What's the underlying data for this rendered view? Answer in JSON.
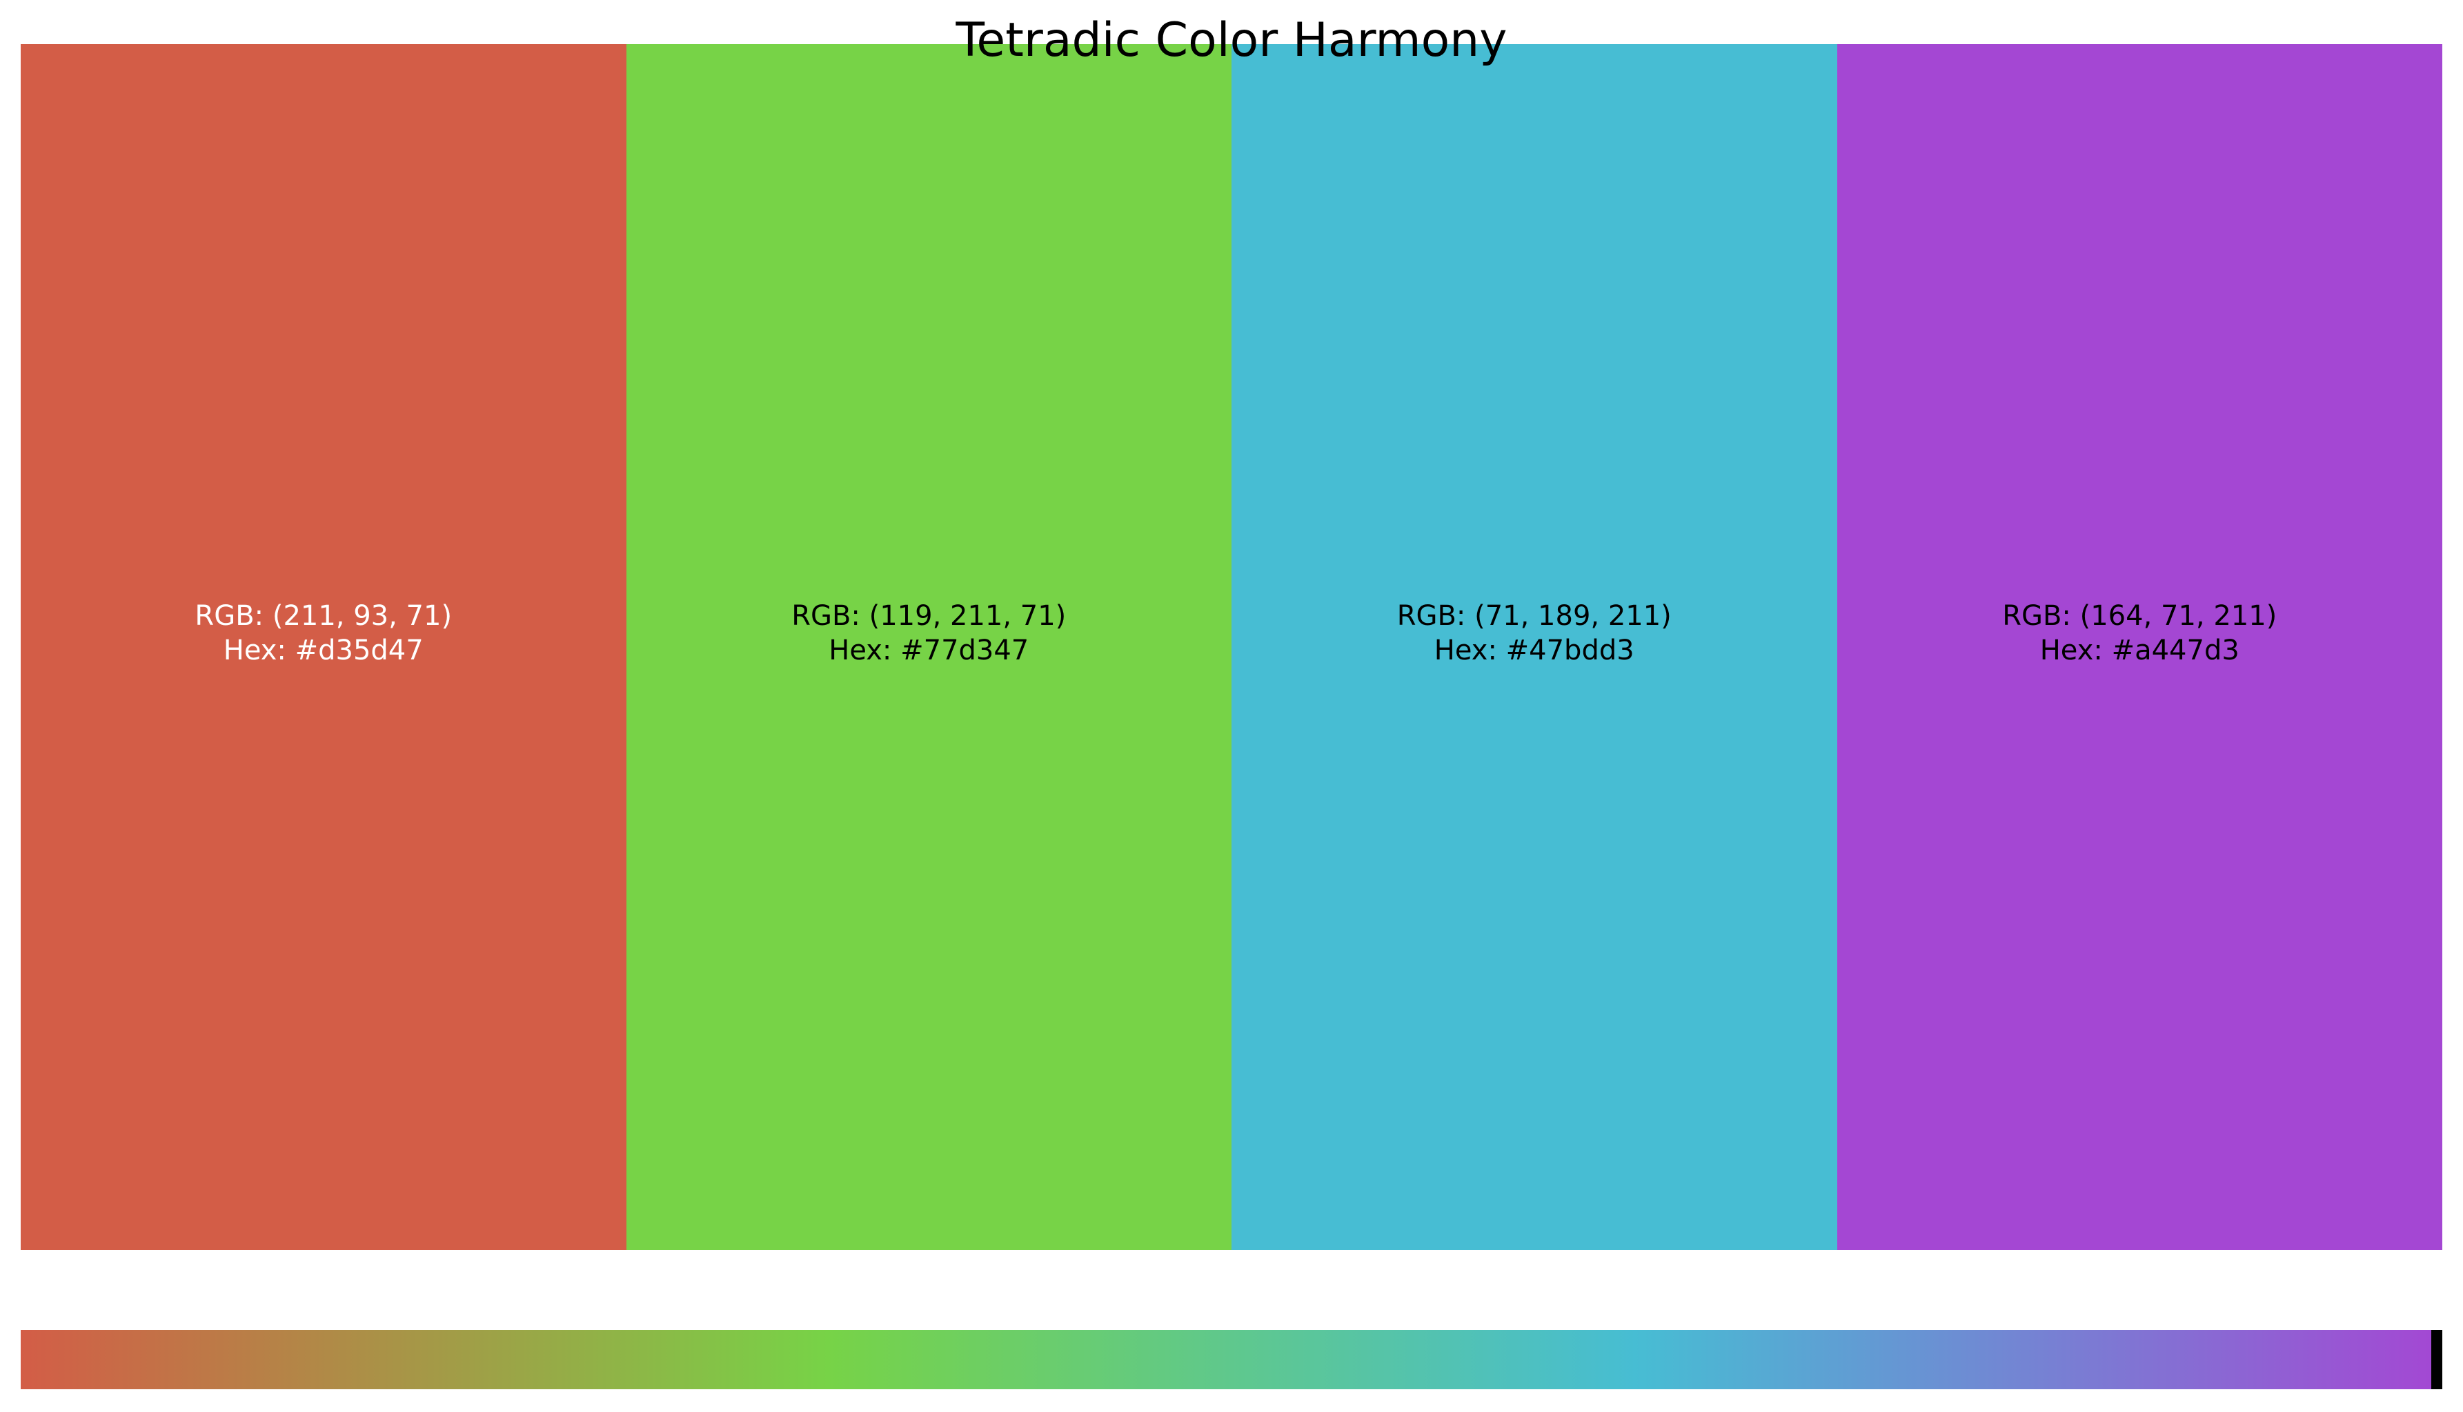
{
  "title": "Tetradic Color Harmony",
  "swatches": [
    {
      "rgb_label": "RGB: (211, 93, 71)",
      "hex_label": "Hex: #d35d47",
      "color": "#d35d47",
      "text_color": "#ffffff"
    },
    {
      "rgb_label": "RGB: (119, 211, 71)",
      "hex_label": "Hex: #77d347",
      "color": "#77d347",
      "text_color": "#000000"
    },
    {
      "rgb_label": "RGB: (71, 189, 211)",
      "hex_label": "Hex: #47bdd3",
      "color": "#47bdd3",
      "text_color": "#000000"
    },
    {
      "rgb_label": "RGB: (164, 71, 211)",
      "hex_label": "Hex: #a447d3",
      "color": "#a447d3",
      "text_color": "#000000"
    }
  ],
  "gradient": {
    "stops": [
      "#d35d47",
      "#77d347",
      "#47bdd3",
      "#a447d3"
    ],
    "marker_color": "#000000"
  }
}
